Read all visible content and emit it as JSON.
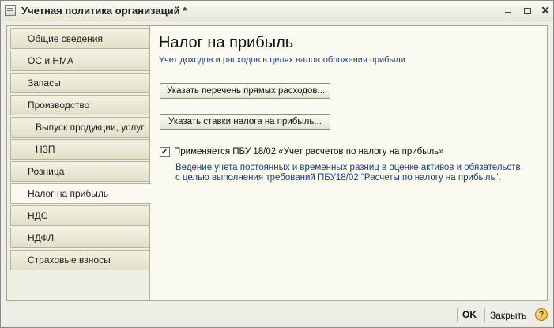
{
  "window": {
    "title": "Учетная политика организаций *",
    "minimize": "minimize",
    "maximize": "maximize",
    "close": "✕"
  },
  "sidebar": {
    "items": [
      {
        "label": "Общие сведения",
        "sub": false,
        "active": false
      },
      {
        "label": "ОС и НМА",
        "sub": false,
        "active": false
      },
      {
        "label": "Запасы",
        "sub": false,
        "active": false
      },
      {
        "label": "Производство",
        "sub": false,
        "active": false
      },
      {
        "label": "Выпуск продукции, услуг",
        "sub": true,
        "active": false
      },
      {
        "label": "НЗП",
        "sub": true,
        "active": false
      },
      {
        "label": "Розница",
        "sub": false,
        "active": false
      },
      {
        "label": "Налог на прибыль",
        "sub": false,
        "active": true
      },
      {
        "label": "НДС",
        "sub": false,
        "active": false
      },
      {
        "label": "НДФЛ",
        "sub": false,
        "active": false
      },
      {
        "label": "Страховые взносы",
        "sub": false,
        "active": false
      }
    ]
  },
  "main": {
    "title": "Налог на прибыль",
    "subtitle": "Учет доходов и расходов в целях налогообложения прибыли",
    "button_direct_costs": "Указать перечень прямых расходов...",
    "button_tax_rates": "Указать ставки налога на прибыль...",
    "pbu_checkbox": {
      "checked": true,
      "mark": "✓",
      "label": "Применяется ПБУ 18/02 «Учет расчетов по налогу на прибыль»"
    },
    "description_line1": "Ведение учета постоянных и временных разниц в оценке активов и обязательств",
    "description_line2": "с целью выполнения требований ПБУ18/02 \"Расчеты по налогу на прибыль\"."
  },
  "footer": {
    "ok_label": "OK",
    "close_label": "Закрыть",
    "help_label": "?"
  },
  "colors": {
    "accent_text": "#1a3d8f",
    "panel_background": "#fbfaf1",
    "tab_background": "#e8e6d0"
  }
}
